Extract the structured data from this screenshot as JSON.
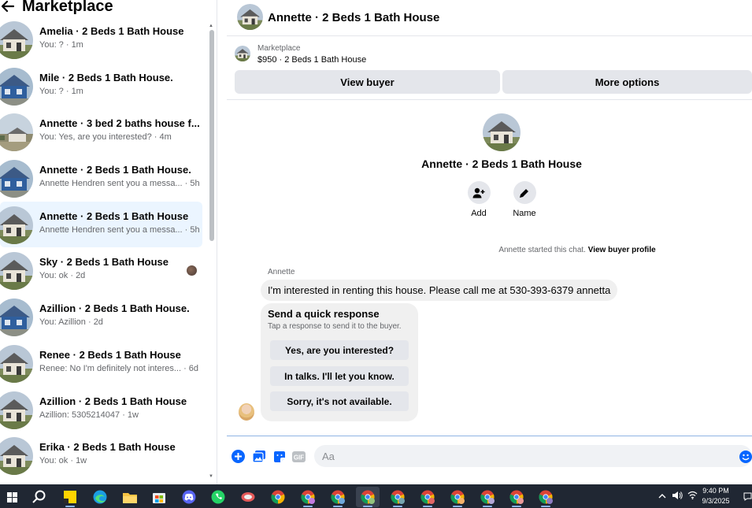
{
  "sidebar": {
    "title": "Marketplace",
    "conversations": [
      {
        "title": "Amelia · 2 Beds 1 Bath House",
        "subtitle": "You: ? · 1m",
        "thumb": "gray-house"
      },
      {
        "title": "Mile · 2 Beds 1 Bath House.",
        "subtitle": "You: ? · 1m",
        "thumb": "blue-house"
      },
      {
        "title": "Annette · 3 bed 2 baths house f...",
        "subtitle": "You: Yes, are you interested? · 4m",
        "thumb": "field-house"
      },
      {
        "title": "Annette · 2 Beds 1 Bath House.",
        "subtitle": "Annette Hendren sent you a messa... · 5h",
        "thumb": "blue-house"
      },
      {
        "title": "Annette · 2 Beds 1 Bath House",
        "subtitle": "Annette Hendren sent you a messa... · 5h",
        "thumb": "gray-house",
        "active": true
      },
      {
        "title": "Sky · 2 Beds 1 Bath House",
        "subtitle": "You: ok · 2d",
        "thumb": "gray-house"
      },
      {
        "title": "Azillion · 2 Beds 1 Bath House.",
        "subtitle": "You: Azillion · 2d",
        "thumb": "blue-house"
      },
      {
        "title": "Renee · 2 Beds 1 Bath House",
        "subtitle": "Renee: No I'm definitely not interes... · 6d",
        "thumb": "gray-house"
      },
      {
        "title": "Azillion · 2 Beds 1 Bath House",
        "subtitle": "Azillion: 5305214047 · 1w",
        "thumb": "gray-house"
      },
      {
        "title": "Erika · 2 Beds 1 Bath House",
        "subtitle": "You: ok · 1w",
        "thumb": "gray-house"
      }
    ]
  },
  "chat": {
    "title": "Annette · 2 Beds 1 Bath House",
    "listing": {
      "category": "Marketplace",
      "price_title": "$950 · 2 Beds 1 Bath House",
      "view_buyer": "View buyer",
      "more_options": "More options"
    },
    "profile": {
      "name": "Annette · 2 Beds 1 Bath House",
      "add_label": "Add",
      "name_label": "Name"
    },
    "started": {
      "text": "Annette started this chat.",
      "link": "View buyer profile"
    },
    "sender_name": "Annette",
    "message": "I'm interested in renting this house. Please call me at 530-393-6379 annetta",
    "quick_response": {
      "title": "Send a quick response",
      "subtitle": "Tap a response to send it to the buyer.",
      "options": [
        "Yes, are you interested?",
        "In talks. I'll let you know.",
        "Sorry, it's not available."
      ]
    },
    "composer": {
      "placeholder": "Aa"
    }
  },
  "taskbar": {
    "time": "9:40 PM",
    "date": "9/3/2025"
  },
  "colors": {
    "accent": "#0866ff",
    "active_row": "#ebf5ff",
    "button_bg": "#e4e6eb",
    "bubble_bg": "#f0f0f0",
    "taskbar": "#202733"
  }
}
